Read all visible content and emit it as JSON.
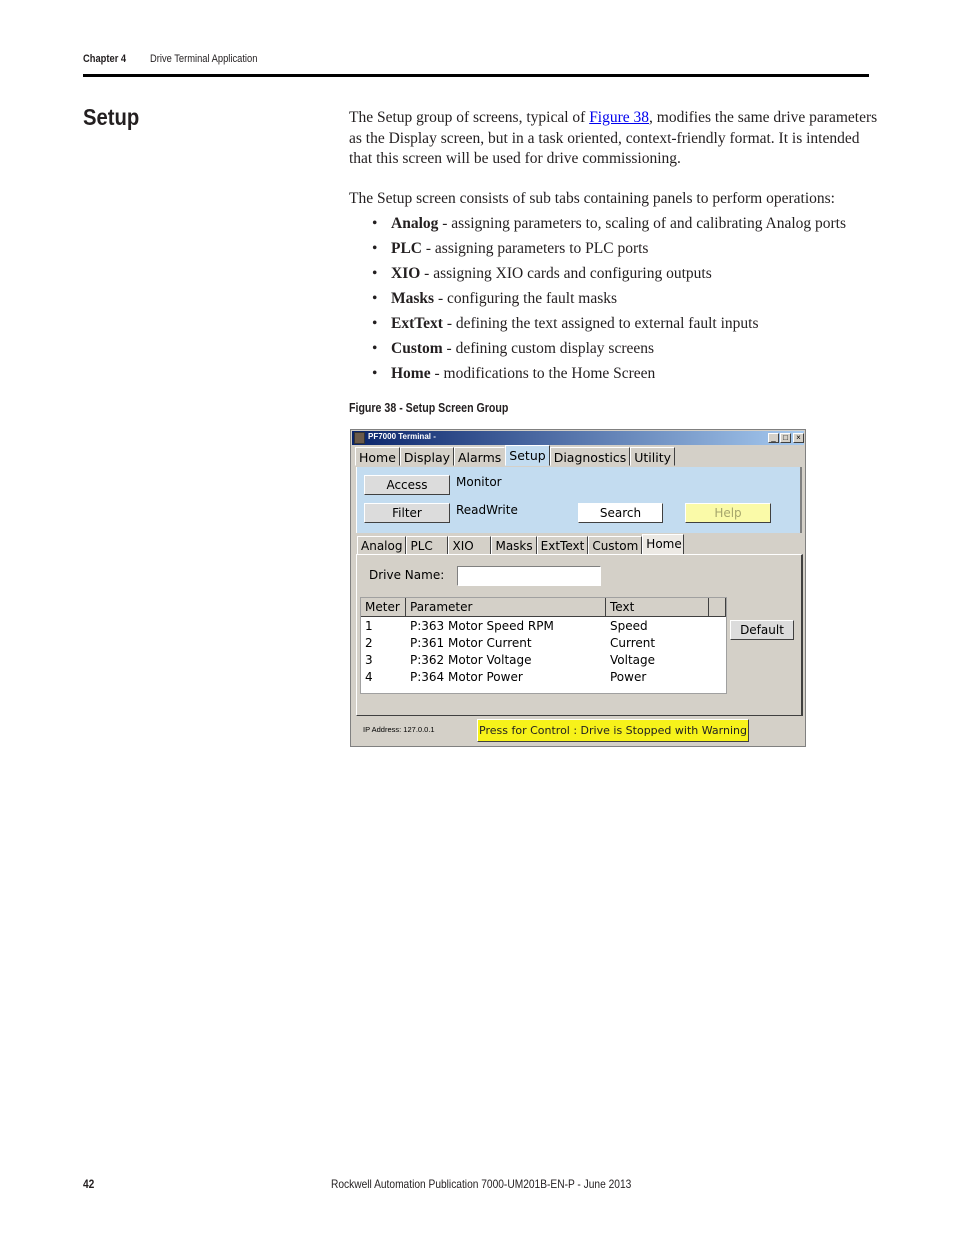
{
  "header": {
    "chapter": "Chapter 4",
    "section": "Drive Terminal Application"
  },
  "heading": "Setup",
  "intro": {
    "before_link": "The Setup group of screens, typical of ",
    "link": "Figure 38",
    "after_link": ", modifies the same drive parameters as the Display screen, but in a task oriented, context-friendly format. It is intended that this screen will be used for drive commissioning."
  },
  "lead": "The Setup screen consists of sub tabs containing panels to perform operations:",
  "bullets": [
    {
      "term": "Analog",
      "desc": " - assigning parameters to, scaling of and calibrating Analog ports"
    },
    {
      "term": "PLC",
      "desc": " - assigning parameters to PLC ports"
    },
    {
      "term": "XIO",
      "desc": " - assigning XIO cards and configuring outputs"
    },
    {
      "term": "Masks",
      "desc": " - configuring the fault masks"
    },
    {
      "term": "ExtText",
      "desc": " - defining the text assigned to external fault inputs"
    },
    {
      "term": "Custom",
      "desc": " - defining custom display screens"
    },
    {
      "term": "Home",
      "desc": " - modifications to the Home Screen"
    }
  ],
  "figure_caption": "Figure 38 - Setup Screen Group",
  "window": {
    "title": "PF7000 Terminal -",
    "controls": {
      "minimize": "_",
      "maximize": "□",
      "close": "×"
    },
    "tabs": [
      "Home",
      "Display",
      "Alarms",
      "Setup",
      "Diagnostics",
      "Utility"
    ],
    "active_tab": "Setup",
    "access_button": "Access",
    "access_value": "Monitor",
    "filter_button": "Filter",
    "filter_value": "ReadWrite",
    "search_button": "Search",
    "help_button": "Help",
    "subtabs": [
      "Analog",
      "PLC",
      "XIO",
      "Masks",
      "ExtText",
      "Custom",
      "Home"
    ],
    "active_subtab": "Home",
    "drive_name_label": "Drive Name:",
    "drive_name_value": "",
    "table": {
      "headers": [
        "Meter",
        "Parameter",
        "Text"
      ],
      "rows": [
        {
          "meter": "1",
          "parameter": "P:363 Motor Speed RPM",
          "text": "Speed"
        },
        {
          "meter": "2",
          "parameter": "P:361 Motor Current",
          "text": "Current"
        },
        {
          "meter": "3",
          "parameter": "P:362 Motor Voltage",
          "text": "Voltage"
        },
        {
          "meter": "4",
          "parameter": "P:364 Motor Power",
          "text": "Power"
        }
      ]
    },
    "default_button": "Default",
    "ip_address": "IP Address: 127.0.0.1",
    "control_button": "Press for Control : Drive is Stopped with Warning"
  },
  "footer": {
    "page": "42",
    "publication": "Rockwell Automation Publication 7000-UM201B-EN-P - June 2013"
  }
}
